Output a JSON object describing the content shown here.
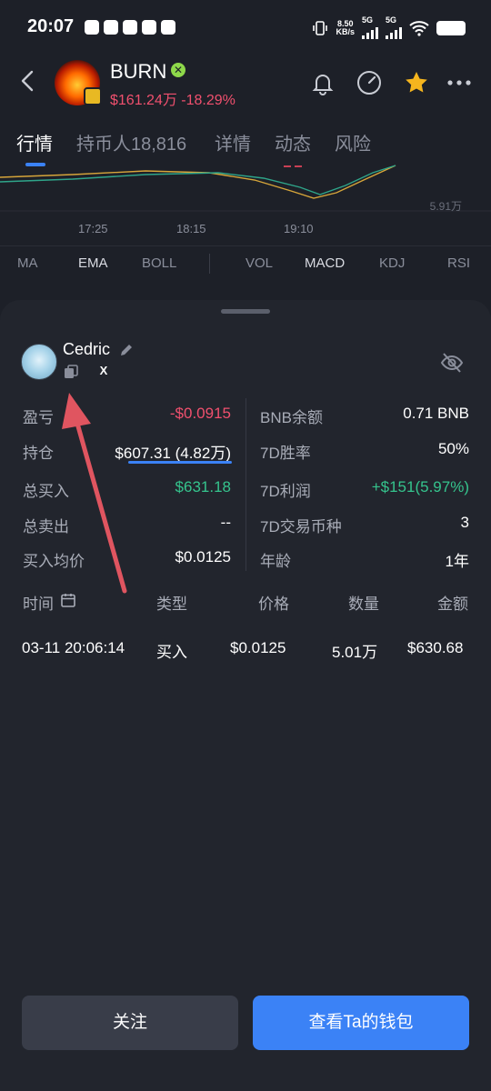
{
  "status_bar": {
    "time": "20:07",
    "net_speed_value": "8.50",
    "net_speed_unit": "KB/s",
    "network_1": "5G",
    "network_2": "5G"
  },
  "header": {
    "token_name": "BURN",
    "price_change": "$161.24万 -18.29%"
  },
  "tabs": [
    {
      "label": "行情",
      "active": true
    },
    {
      "label": "持币人18,816",
      "active": false
    },
    {
      "label": "详情",
      "active": false
    },
    {
      "label": "动态",
      "active": false
    },
    {
      "label": "风险",
      "active": false
    }
  ],
  "chart": {
    "value_label": "5.91万",
    "times": [
      "17:25",
      "18:15",
      "19:10"
    ]
  },
  "indicators": [
    {
      "label": "MA",
      "active": false
    },
    {
      "label": "EMA",
      "active": true
    },
    {
      "label": "BOLL",
      "active": false
    },
    {
      "label": "VOL",
      "active": false
    },
    {
      "label": "MACD",
      "active": true
    },
    {
      "label": "KDJ",
      "active": false
    },
    {
      "label": "RSI",
      "active": false
    }
  ],
  "holder": {
    "name": "Cedric",
    "social_x": "X"
  },
  "stats_left": [
    {
      "label": "盈亏",
      "value": "-$0.0915"
    },
    {
      "label": "持仓",
      "value": "$607.31 (4.82万)"
    },
    {
      "label": "总买入",
      "value": "$631.18"
    },
    {
      "label": "总卖出",
      "value": "--"
    },
    {
      "label": "买入均价",
      "value": "$0.0125"
    }
  ],
  "stats_right": [
    {
      "label": "BNB余额",
      "value": "0.71 BNB"
    },
    {
      "label": "7D胜率",
      "value": "50%"
    },
    {
      "label": "7D利润",
      "value": "+$151(5.97%)"
    },
    {
      "label": "7D交易币种",
      "value": "3"
    },
    {
      "label": "年龄",
      "value": "1年"
    }
  ],
  "table": {
    "headers": [
      "时间",
      "类型",
      "价格",
      "数量",
      "金额"
    ],
    "rows": [
      {
        "time": "03-11 20:06:14",
        "type": "买入",
        "price": "$0.0125",
        "qty": "5.01万",
        "amount": "$630.68"
      }
    ]
  },
  "buttons": {
    "follow": "关注",
    "view_wallet": "查看Ta的钱包"
  },
  "colors": {
    "accent": "#3b82f6",
    "negative": "#f0506e",
    "positive": "#35c48d",
    "annotation_arrow": "#e05560"
  }
}
